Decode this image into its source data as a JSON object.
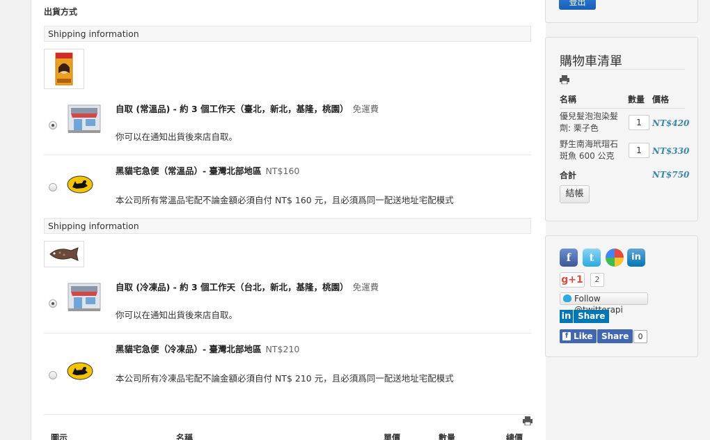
{
  "section_title": "出貨方式",
  "shipping_groups": [
    {
      "header": "Shipping information",
      "options": [
        {
          "title": "自取 (常溫品) - 約 3 個工作天（臺北，新北，基隆，桃園）",
          "fee": "免運費",
          "description": "你可以在通知出貨後來店自取。",
          "selected": true,
          "icon": "store-icon"
        },
        {
          "title": "黑貓宅急便（常溫品）- 臺灣北部地區",
          "fee": "NT$160",
          "description": "本公司所有常溫品宅配不論金額必須自付 NT$ 160 元，且必須爲同一配送地址宅配模式",
          "selected": false,
          "icon": "black-cat-icon"
        }
      ]
    },
    {
      "header": "Shipping information",
      "options": [
        {
          "title": "自取 (冷凍品) - 約 3 個工作天（台北，新北，基隆，桃園）",
          "fee": "免運費",
          "description": "你可以在通知出貨後來店自取。",
          "selected": true,
          "icon": "store-icon"
        },
        {
          "title": "黑貓宅急便（冷凍品）- 臺灣北部地區",
          "fee": "NT$210",
          "description": "本公司所有冷凍品宅配不論金額必須自付 NT$ 210 元，且必須爲同一配送地址宅配模式",
          "selected": false,
          "icon": "black-cat-icon"
        }
      ]
    }
  ],
  "cart_table_headers": [
    "圖示",
    "名稱",
    "單價",
    "數量",
    "總價"
  ],
  "login_label": "登出",
  "cart": {
    "title": "購物車清單",
    "headers": {
      "name": "名稱",
      "qty": "數量",
      "price": "價格"
    },
    "items": [
      {
        "name": "優兒髮泡泡染髮劑: 栗子色",
        "qty": "1",
        "price": "NT$420"
      },
      {
        "name": "野生南海玳瑁石斑魚 600 公克",
        "qty": "1",
        "price": "NT$330"
      }
    ],
    "total_label": "合計",
    "total": "NT$750",
    "checkout_label": "結帳"
  },
  "social": {
    "gplus_label": "g+1",
    "gplus_count": "2",
    "twitter_follow": "Follow @twitterapi",
    "linkedin_share": "Share",
    "fb_like": "Like",
    "fb_share": "Share",
    "fb_count": "0"
  },
  "colors": {
    "price": "#3a87ad",
    "login": "#1a5fb4",
    "linkedin": "#0077b5",
    "facebook": "#4267b2"
  }
}
